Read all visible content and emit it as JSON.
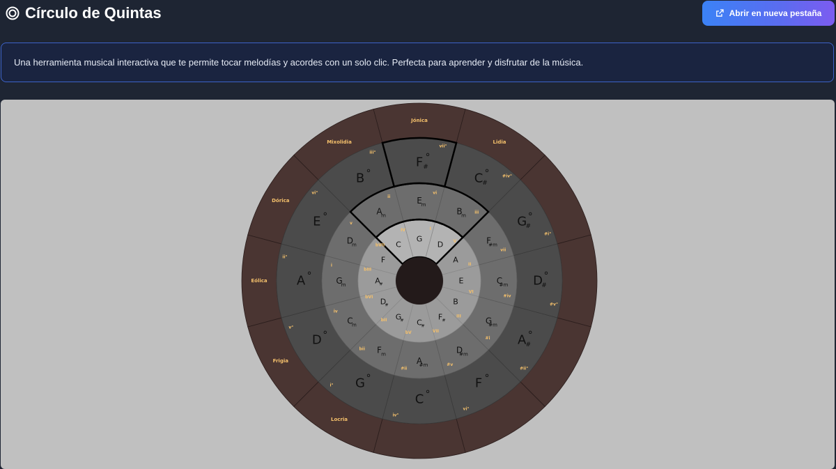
{
  "header": {
    "title": "Círculo de Quintas",
    "open_button_label": "Abrir en nueva pestaña"
  },
  "description": "Una herramienta musical interactiva que te permite tocar melodías y acordes con un solo clic. Perfecta para aprender y disfrutar de la música.",
  "colors": {
    "header_bg": "#1e2533",
    "button_gradient_start": "#3b82f6",
    "button_gradient_end": "#7c5cf0",
    "panel_bg": "#c0c0c0",
    "ring_mode": "#4a3532",
    "ring_dim": "#4b4b4b",
    "ring_minor": "#6d6d6d",
    "ring_major": "#9b9b9b",
    "ring_inner": "#b3b3b3",
    "center": "#231a1a",
    "highlight_text": "#7fd9d0",
    "tonic_text": "#d0344a",
    "degree_text": "#f5c16c"
  },
  "circle": {
    "modes": [
      "Jónica",
      "Lidia",
      "",
      "",
      "",
      "",
      "",
      "Locria",
      "Frigia",
      "Eólica",
      "Dórica",
      "Mixolidia"
    ],
    "dim_ring": [
      {
        "chord": "F",
        "acc": "#",
        "deg": "vii°"
      },
      {
        "chord": "C",
        "acc": "#",
        "deg": "#iv°"
      },
      {
        "chord": "G",
        "acc": "#",
        "deg": "#i°"
      },
      {
        "chord": "D",
        "acc": "#",
        "deg": "#v°"
      },
      {
        "chord": "A",
        "acc": "#",
        "deg": "#ii°"
      },
      {
        "chord": "F",
        "acc": "",
        "deg": "vi°"
      },
      {
        "chord": "C",
        "acc": "",
        "deg": "iv°"
      },
      {
        "chord": "G",
        "acc": "",
        "deg": "i°"
      },
      {
        "chord": "D",
        "acc": "",
        "deg": "v°"
      },
      {
        "chord": "A",
        "acc": "",
        "deg": "ii°"
      },
      {
        "chord": "E",
        "acc": "",
        "deg": "vi°"
      },
      {
        "chord": "B",
        "acc": "",
        "deg": "iii°"
      }
    ],
    "minor_ring": [
      {
        "chord": "E",
        "sub": "m",
        "deg": "vi"
      },
      {
        "chord": "B",
        "sub": "m",
        "deg": "iii"
      },
      {
        "chord": "F",
        "sub": "#m",
        "deg": "vii"
      },
      {
        "chord": "C",
        "sub": "#m",
        "deg": "#iv"
      },
      {
        "chord": "G",
        "sub": "#m",
        "deg": "#i"
      },
      {
        "chord": "D",
        "sub": "#m",
        "deg": "#v"
      },
      {
        "chord": "A",
        "sub": "#m",
        "deg": "#ii"
      },
      {
        "chord": "F",
        "sub": "m",
        "deg": "bii"
      },
      {
        "chord": "C",
        "sub": "m",
        "deg": "iv"
      },
      {
        "chord": "G",
        "sub": "m",
        "deg": "i"
      },
      {
        "chord": "D",
        "sub": "m",
        "deg": "v"
      },
      {
        "chord": "A",
        "sub": "m",
        "deg": "ii"
      }
    ],
    "major_ring": [
      {
        "chord": "G",
        "sub": "",
        "deg": "I"
      },
      {
        "chord": "D",
        "sub": "",
        "deg": "V"
      },
      {
        "chord": "A",
        "sub": "",
        "deg": "II"
      },
      {
        "chord": "E",
        "sub": "",
        "deg": "VI"
      },
      {
        "chord": "B",
        "sub": "",
        "deg": "III"
      },
      {
        "chord": "F",
        "sub": "#",
        "deg": "VII"
      },
      {
        "chord": "C",
        "sub": "#",
        "deg": "bV"
      },
      {
        "chord": "G",
        "sub": "#",
        "deg": "bII"
      },
      {
        "chord": "D",
        "sub": "#",
        "deg": "bVI"
      },
      {
        "chord": "A",
        "sub": "#",
        "deg": "bIII"
      },
      {
        "chord": "F",
        "sub": "",
        "deg": "bVII"
      },
      {
        "chord": "C",
        "sub": "",
        "deg": "IV"
      }
    ],
    "highlight_segments": [
      0,
      1,
      11
    ]
  }
}
